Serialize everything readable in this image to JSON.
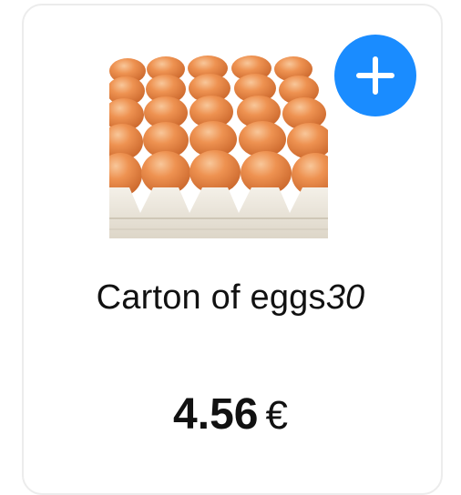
{
  "product": {
    "name": "Carton of eggs",
    "quantity": "30",
    "price": "4.56",
    "currency": "€",
    "image_icon": "egg-carton-image"
  },
  "actions": {
    "add_icon": "plus-icon"
  },
  "colors": {
    "add_button": "#1a8cff",
    "card_border": "#ececec",
    "egg": "#e9823e",
    "tray": "#ece7dd"
  }
}
